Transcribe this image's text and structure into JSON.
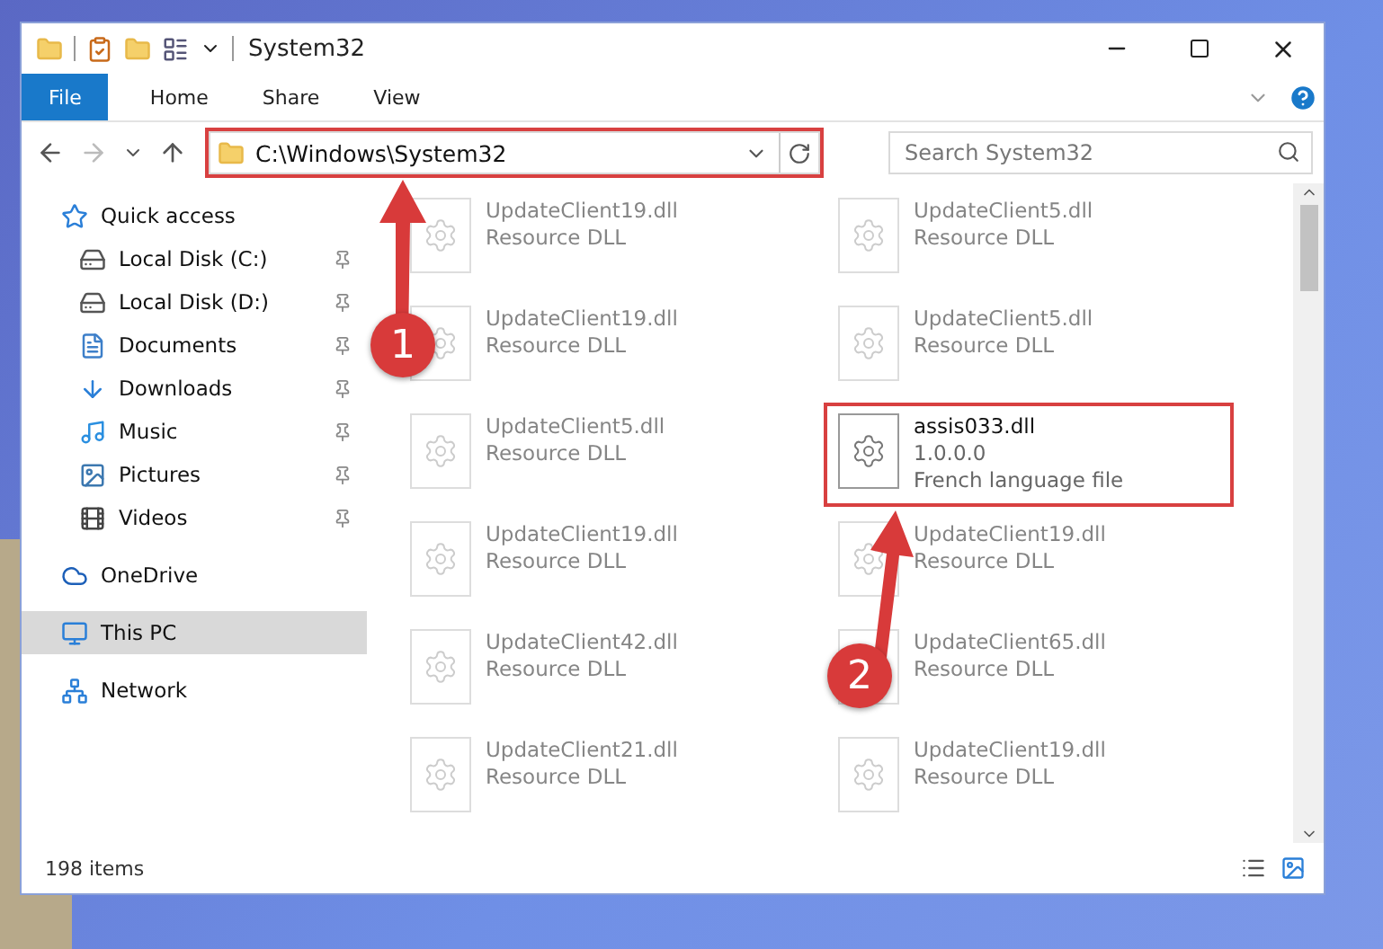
{
  "window": {
    "title": "System32"
  },
  "ribbon_tabs": [
    {
      "label": "File",
      "selected": true
    },
    {
      "label": "Home",
      "selected": false
    },
    {
      "label": "Share",
      "selected": false
    },
    {
      "label": "View",
      "selected": false
    }
  ],
  "address_bar": {
    "path": "C:\\Windows\\System32",
    "highlighted": true
  },
  "search": {
    "placeholder": "Search System32"
  },
  "sidebar": {
    "items": [
      {
        "label": "Quick access",
        "kind": "star",
        "selected": false,
        "children": [
          {
            "label": "Local Disk (C:)",
            "kind": "drive",
            "pinned": true,
            "selected": false
          },
          {
            "label": "Local Disk (D:)",
            "kind": "drive",
            "pinned": true,
            "selected": false
          },
          {
            "label": "Documents",
            "kind": "document",
            "pinned": true,
            "selected": false
          },
          {
            "label": "Downloads",
            "kind": "download",
            "pinned": true,
            "selected": false
          },
          {
            "label": "Music",
            "kind": "music",
            "pinned": true,
            "selected": false
          },
          {
            "label": "Pictures",
            "kind": "picture",
            "pinned": true,
            "selected": false
          },
          {
            "label": "Videos",
            "kind": "video",
            "pinned": true,
            "selected": false
          }
        ]
      },
      {
        "label": "OneDrive",
        "kind": "cloud",
        "selected": false
      },
      {
        "label": "This PC",
        "kind": "monitor",
        "selected": true
      },
      {
        "label": "Network",
        "kind": "network",
        "selected": false
      }
    ]
  },
  "files": [
    {
      "name": "UpdateClient19.dll",
      "details": [
        "Resource DLL"
      ],
      "highlighted": false
    },
    {
      "name": "UpdateClient5.dll",
      "details": [
        "Resource DLL"
      ],
      "highlighted": false
    },
    {
      "name": "UpdateClient19.dll",
      "details": [
        "Resource DLL"
      ],
      "highlighted": false
    },
    {
      "name": "UpdateClient5.dll",
      "details": [
        "Resource DLL"
      ],
      "highlighted": false
    },
    {
      "name": "UpdateClient5.dll",
      "details": [
        "Resource DLL"
      ],
      "highlighted": false
    },
    {
      "name": "assis033.dll",
      "details": [
        "1.0.0.0",
        "French language file"
      ],
      "highlighted": true
    },
    {
      "name": "UpdateClient19.dll",
      "details": [
        "Resource DLL"
      ],
      "highlighted": false
    },
    {
      "name": "UpdateClient19.dll",
      "details": [
        "Resource DLL"
      ],
      "highlighted": false
    },
    {
      "name": "UpdateClient42.dll",
      "details": [
        "Resource DLL"
      ],
      "highlighted": false
    },
    {
      "name": "UpdateClient65.dll",
      "details": [
        "Resource DLL"
      ],
      "highlighted": false
    },
    {
      "name": "UpdateClient21.dll",
      "details": [
        "Resource DLL"
      ],
      "highlighted": false
    },
    {
      "name": "UpdateClient19.dll",
      "details": [
        "Resource DLL"
      ],
      "highlighted": false
    }
  ],
  "status_bar": {
    "item_count": "198 items"
  },
  "callouts": [
    {
      "number": "1"
    },
    {
      "number": "2"
    }
  ]
}
